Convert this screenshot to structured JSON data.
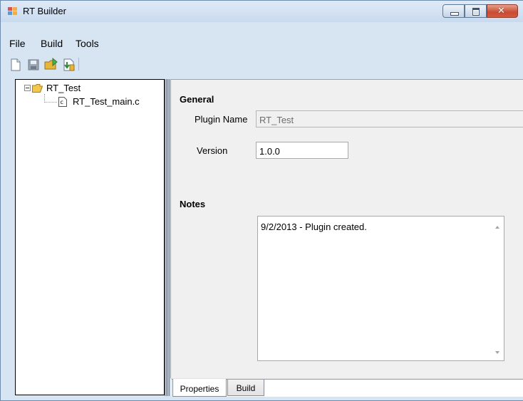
{
  "window": {
    "title": "RT Builder"
  },
  "menu": [
    "File",
    "Build",
    "Tools"
  ],
  "toolbar": {
    "buttons": [
      "new-file-icon",
      "save-icon",
      "open-plugin-icon",
      "import-icon"
    ]
  },
  "tree": {
    "root_label": "RT_Test",
    "child_label": "RT_Test_main.c"
  },
  "properties": {
    "general_heading": "General",
    "plugin_name_label": "Plugin Name",
    "plugin_name_value": "RT_Test",
    "version_label": "Version",
    "version_value": "1.0.0",
    "notes_heading": "Notes",
    "notes_value": "9/2/2013 - Plugin created."
  },
  "tabs": [
    "Properties",
    "Build"
  ],
  "colors": {
    "frame": "#d7e4f2",
    "panel": "#f0f0f0",
    "close_button": "#c94a31"
  }
}
